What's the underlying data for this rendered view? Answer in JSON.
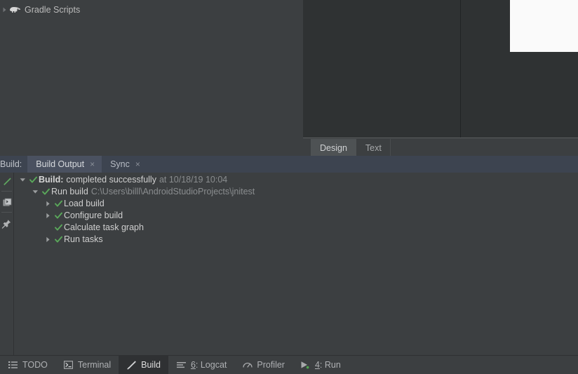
{
  "project_tree": {
    "rows": [
      {
        "label": "Gradle Scripts",
        "icon": "gradle-elephant-icon",
        "expander": "collapsed-arrow-icon"
      }
    ]
  },
  "editor": {
    "tabs": [
      {
        "label": "Design",
        "active": true
      },
      {
        "label": "Text",
        "active": false
      }
    ]
  },
  "build_window": {
    "title": "Build:",
    "tabs": [
      {
        "label": "Build Output",
        "close": "×",
        "active": true
      },
      {
        "label": "Sync",
        "close": "×",
        "active": false
      }
    ],
    "toolbar": [
      {
        "icon": "build-hammer-icon"
      },
      {
        "icon": "run-console-icon"
      },
      {
        "icon": "pin-icon"
      }
    ],
    "tree": [
      {
        "indent": 0,
        "expander": "expanded-arrow-icon",
        "status": "success-check-icon",
        "label_strong": "Build:",
        "label": "completed successfully",
        "detail": "at 10/18/19 10:04"
      },
      {
        "indent": 1,
        "expander": "expanded-arrow-icon",
        "status": "success-check-icon",
        "label_strong": "",
        "label": "Run build",
        "detail": "C:\\Users\\billl\\AndroidStudioProjects\\jnitest"
      },
      {
        "indent": 2,
        "expander": "collapsed-arrow-icon",
        "status": "success-check-icon",
        "label_strong": "",
        "label": "Load build",
        "detail": ""
      },
      {
        "indent": 2,
        "expander": "collapsed-arrow-icon",
        "status": "success-check-icon",
        "label_strong": "",
        "label": "Configure build",
        "detail": ""
      },
      {
        "indent": 2,
        "expander": "",
        "status": "success-check-icon",
        "label_strong": "",
        "label": "Calculate task graph",
        "detail": ""
      },
      {
        "indent": 2,
        "expander": "collapsed-arrow-icon",
        "status": "success-check-icon",
        "label_strong": "",
        "label": "Run tasks",
        "detail": ""
      }
    ]
  },
  "statusbar": {
    "items": [
      {
        "label": "TODO",
        "icon": "todo-list-icon",
        "prefix": "",
        "active": false
      },
      {
        "label": "Terminal",
        "icon": "terminal-icon",
        "prefix": "",
        "active": false
      },
      {
        "label": "Build",
        "icon": "build-hammer-icon",
        "prefix": "",
        "active": true
      },
      {
        "label": ": Logcat",
        "icon": "logcat-icon",
        "prefix": "6",
        "active": false
      },
      {
        "label": "Profiler",
        "icon": "profiler-gauge-icon",
        "prefix": "",
        "active": false
      },
      {
        "label": ": Run",
        "icon": "run-play-icon",
        "prefix": "4",
        "active": false
      }
    ]
  },
  "colors": {
    "background": "#3c3f41",
    "editor_bg": "#2f3233",
    "build_header_bg": "#3d4450",
    "build_tab_active_bg": "#4a5160",
    "success_green": "#4e9a4e",
    "text_primary": "#cfcfcf",
    "text_dim": "#8a8d8f",
    "preview_white": "#fafafa"
  }
}
